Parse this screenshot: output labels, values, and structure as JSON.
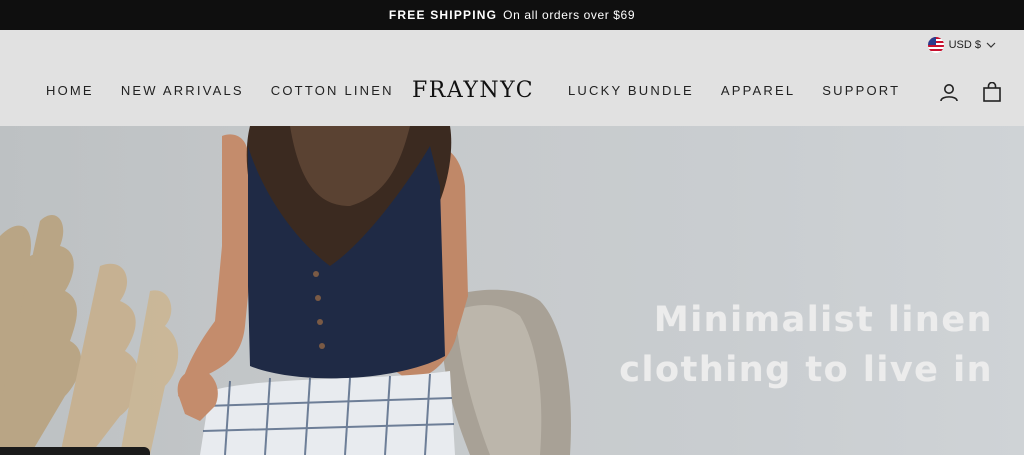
{
  "announcement": {
    "bold": "FREE SHIPPING",
    "text": "On all orders over $69"
  },
  "currency": {
    "label": "USD $",
    "flag_icon": "us-flag-icon"
  },
  "nav_left": [
    "HOME",
    "NEW ARRIVALS",
    "COTTON LINEN"
  ],
  "logo": "FRAYNYC",
  "nav_right": [
    "LUCKY BUNDLE",
    "APPAREL",
    "SUPPORT"
  ],
  "icons": {
    "account": "account-icon",
    "cart": "cart-icon"
  },
  "hero": {
    "headline_line1": "Minimalist linen",
    "headline_line2": "clothing to live in"
  },
  "colors": {
    "announce_bg": "#0f0f0f",
    "header_bg": "#e1e1e1",
    "headline": "#ececec"
  }
}
